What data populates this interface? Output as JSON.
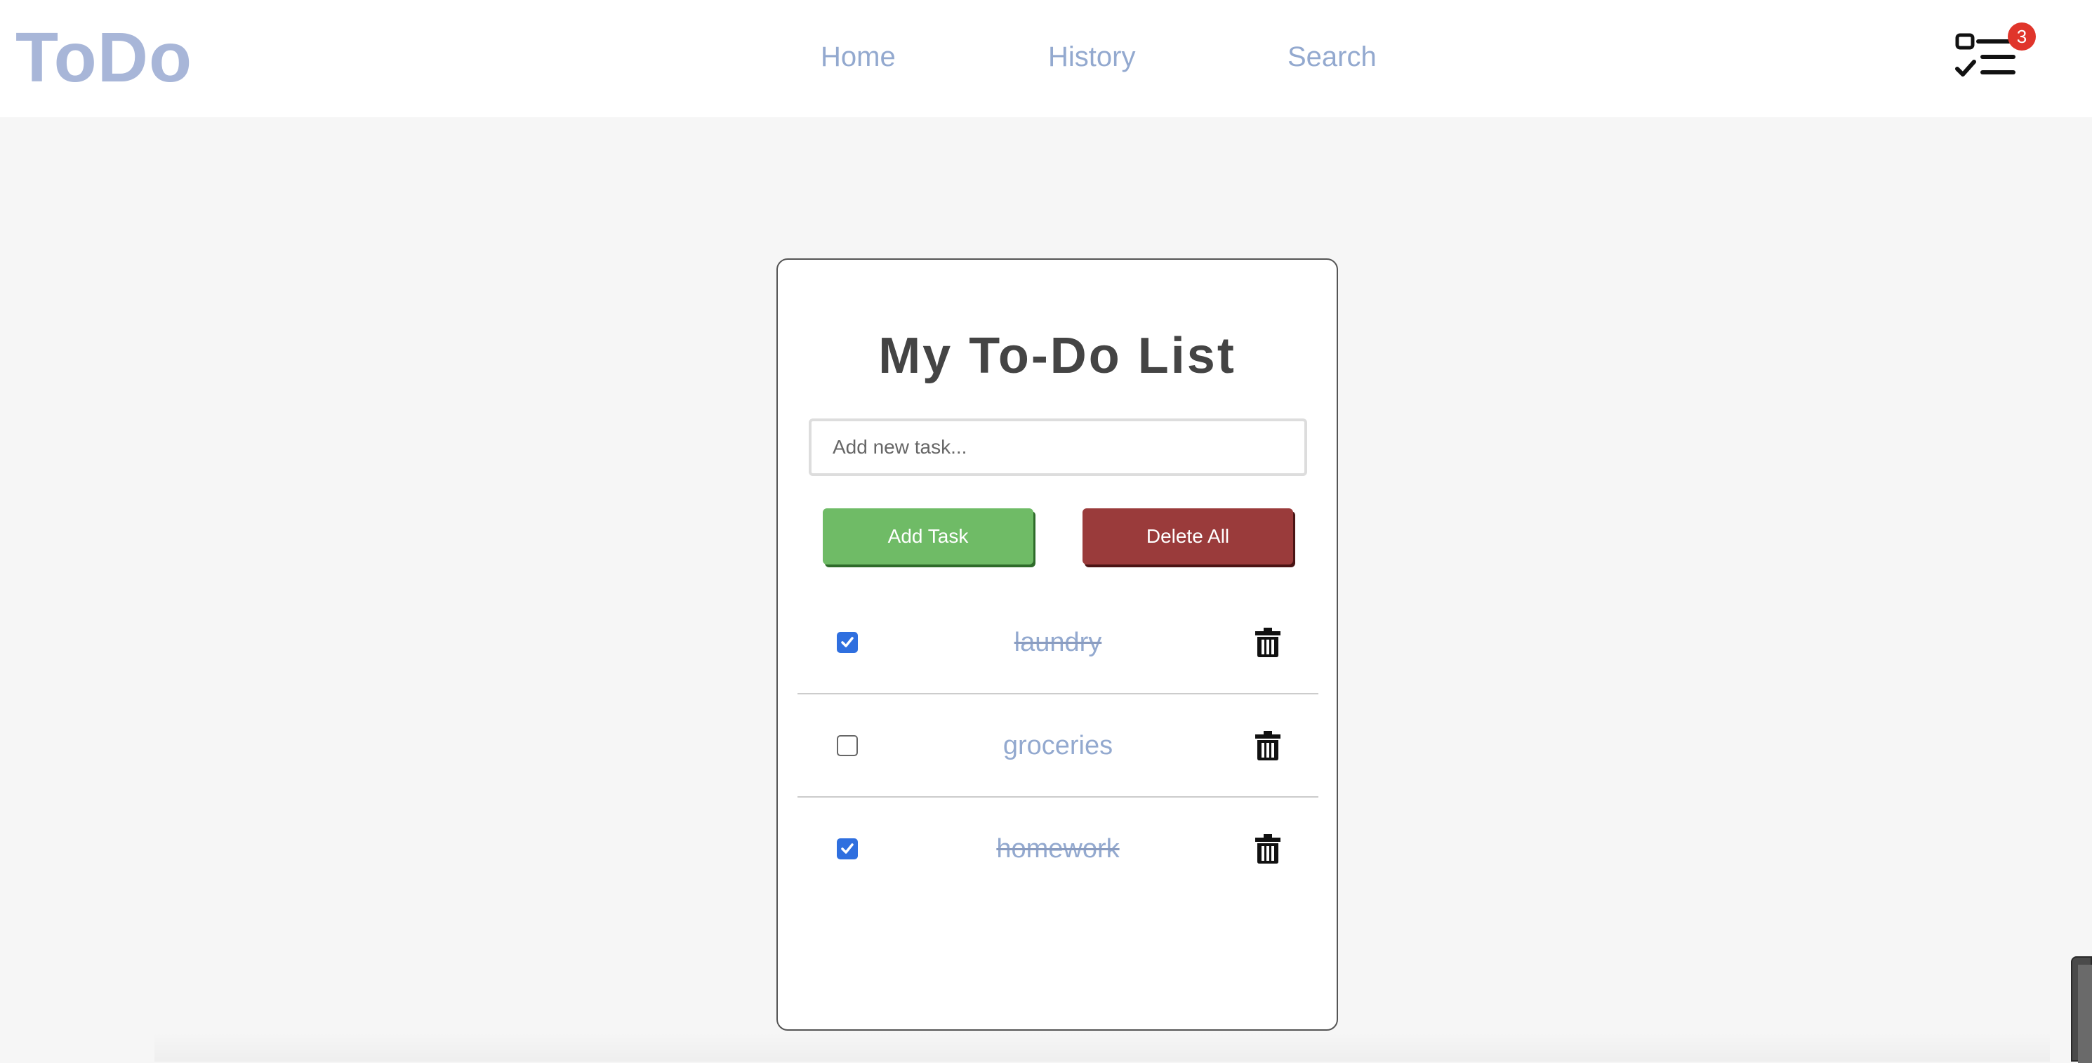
{
  "header": {
    "logo": "ToDo",
    "nav": [
      {
        "label": "Home"
      },
      {
        "label": "History"
      },
      {
        "label": "Search"
      }
    ],
    "tasks_icon": "checklist-icon",
    "badge_count": "3"
  },
  "main": {
    "title": "My To-Do List",
    "input": {
      "value": "",
      "placeholder": "Add new task..."
    },
    "add_button": "Add Task",
    "delete_all_button": "Delete All",
    "tasks": [
      {
        "text": "laundry",
        "completed": true
      },
      {
        "text": "groceries",
        "completed": false
      },
      {
        "text": "homework",
        "completed": true
      }
    ],
    "delete_icon": "trash-icon"
  },
  "colors": {
    "accent_text": "#93a9cf",
    "add_button": "#6fbb66",
    "delete_button": "#9a3b3b",
    "badge": "#e0352b",
    "checkbox_checked": "#2f6fdf"
  }
}
